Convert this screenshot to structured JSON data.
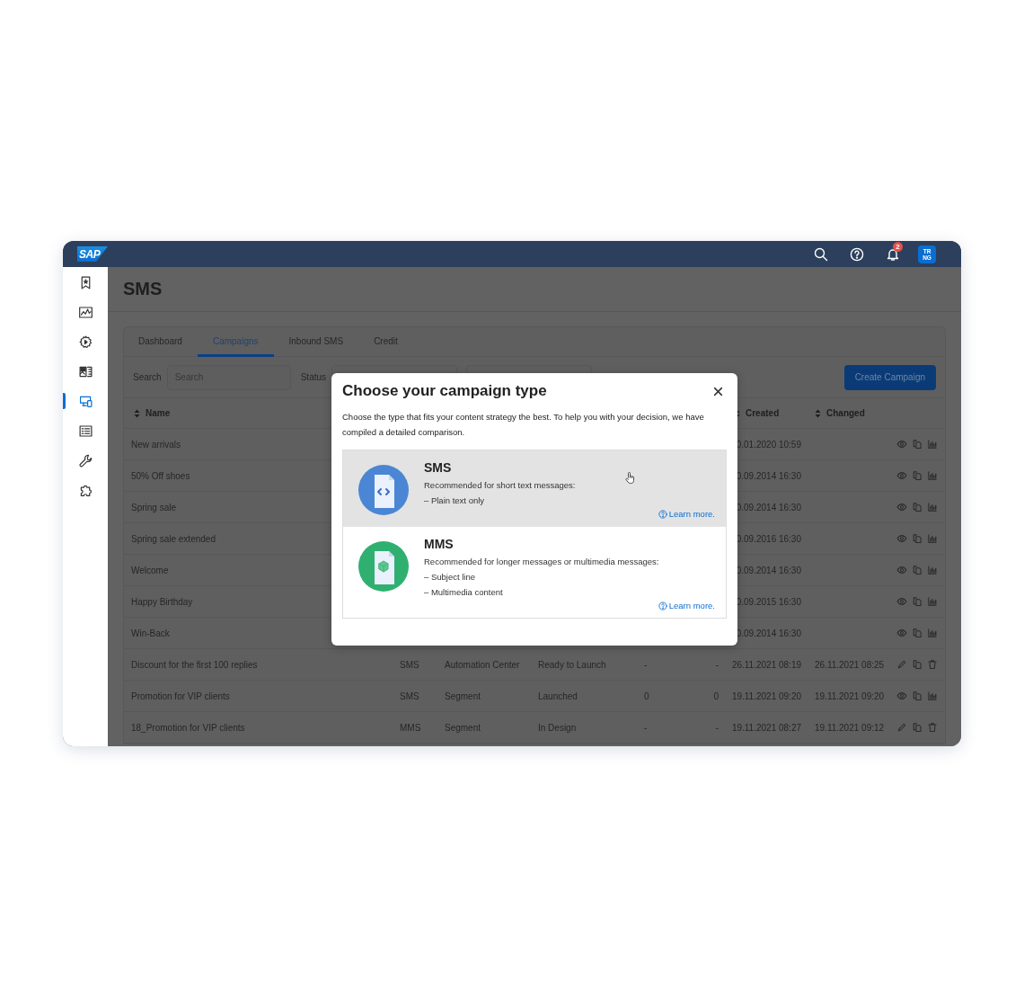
{
  "header": {
    "logo": "SAP",
    "notifications_badge": "2",
    "avatar": "TR NG"
  },
  "sidebar": {
    "items": [
      {
        "kind": "bookmark",
        "selected": false
      },
      {
        "kind": "chart",
        "selected": false
      },
      {
        "kind": "automation",
        "selected": false
      },
      {
        "kind": "content",
        "selected": false
      },
      {
        "kind": "channels",
        "selected": true
      },
      {
        "kind": "contacts",
        "selected": false
      },
      {
        "kind": "tools",
        "selected": false
      },
      {
        "kind": "extensions",
        "selected": false
      }
    ]
  },
  "page": {
    "title": "SMS"
  },
  "tabs": [
    {
      "label": "Dashboard",
      "selected": false
    },
    {
      "label": "Campaigns",
      "selected": true
    },
    {
      "label": "Inbound SMS",
      "selected": false
    },
    {
      "label": "Credit",
      "selected": false
    }
  ],
  "filters": {
    "search_label": "Search",
    "search_placeholder": "Search",
    "status_label": "Status"
  },
  "create_button": "Create Campaign",
  "table": {
    "headers": {
      "name": "Name",
      "created": "Created",
      "changed": "Changed"
    },
    "rows": [
      {
        "name": "New arrivals",
        "created": "0.01.2020 10:59",
        "actions": [
          {
            "kind": "view"
          },
          {
            "kind": "copy"
          },
          {
            "kind": "analytics"
          }
        ]
      },
      {
        "name": "50% Off shoes",
        "created": "0.09.2014 16:30",
        "actions": [
          {
            "kind": "view"
          },
          {
            "kind": "copy"
          },
          {
            "kind": "analytics"
          }
        ]
      },
      {
        "name": "Spring sale",
        "created": "0.09.2014 16:30",
        "actions": [
          {
            "kind": "view"
          },
          {
            "kind": "copy"
          },
          {
            "kind": "analytics"
          }
        ]
      },
      {
        "name": "Spring sale extended",
        "created": "0.09.2016 16:30",
        "actions": [
          {
            "kind": "view"
          },
          {
            "kind": "copy"
          },
          {
            "kind": "analytics"
          }
        ]
      },
      {
        "name": "Welcome",
        "created": "0.09.2014 16:30",
        "actions": [
          {
            "kind": "view"
          },
          {
            "kind": "copy"
          },
          {
            "kind": "analytics"
          }
        ]
      },
      {
        "name": "Happy Birthday",
        "created": "0.09.2015 16:30",
        "actions": [
          {
            "kind": "view"
          },
          {
            "kind": "copy"
          },
          {
            "kind": "analytics"
          }
        ]
      },
      {
        "name": "Win-Back",
        "created": "0.09.2014 16:30",
        "actions": [
          {
            "kind": "view"
          },
          {
            "kind": "copy"
          },
          {
            "kind": "analytics"
          }
        ]
      },
      {
        "name": "Discount for the first 100 replies",
        "type": "SMS",
        "source": "Automation Center",
        "status": "Ready to Launch",
        "column_5": "-",
        "column_6": "-",
        "created": "26.11.2021 08:19",
        "changed": "26.11.2021 08:25",
        "actions": [
          {
            "kind": "edit"
          },
          {
            "kind": "copy"
          },
          {
            "kind": "delete"
          }
        ]
      },
      {
        "name": "Promotion for VIP clients",
        "type": "SMS",
        "source": "Segment",
        "status": "Launched",
        "column_5": "0",
        "column_6": "0",
        "created": "19.11.2021 09:20",
        "changed": "19.11.2021 09:20",
        "actions": [
          {
            "kind": "view"
          },
          {
            "kind": "copy"
          },
          {
            "kind": "analytics"
          }
        ]
      },
      {
        "name": "18_Promotion for VIP clients",
        "type": "MMS",
        "source": "Segment",
        "status": "In Design",
        "column_5": "-",
        "column_6": "-",
        "created": "19.11.2021 08:27",
        "changed": "19.11.2021 09:12",
        "actions": [
          {
            "kind": "edit"
          },
          {
            "kind": "copy"
          },
          {
            "kind": "delete"
          }
        ]
      }
    ]
  },
  "modal": {
    "title": "Choose your campaign type",
    "description": "Choose the type that fits your content strategy the best. To help you with your decision, we have compiled a detailed comparison.",
    "options": [
      {
        "kind": "sms",
        "title": "SMS",
        "selected": true,
        "description": "Recommended for short text messages:",
        "bullets": [
          "– Plain text only"
        ],
        "link": "Learn more."
      },
      {
        "kind": "mms",
        "title": "MMS",
        "selected": false,
        "description": "Recommended for longer messages or multimedia messages:",
        "bullets": [
          "– Subject line",
          "– Multimedia content"
        ],
        "link": "Learn more."
      }
    ]
  }
}
